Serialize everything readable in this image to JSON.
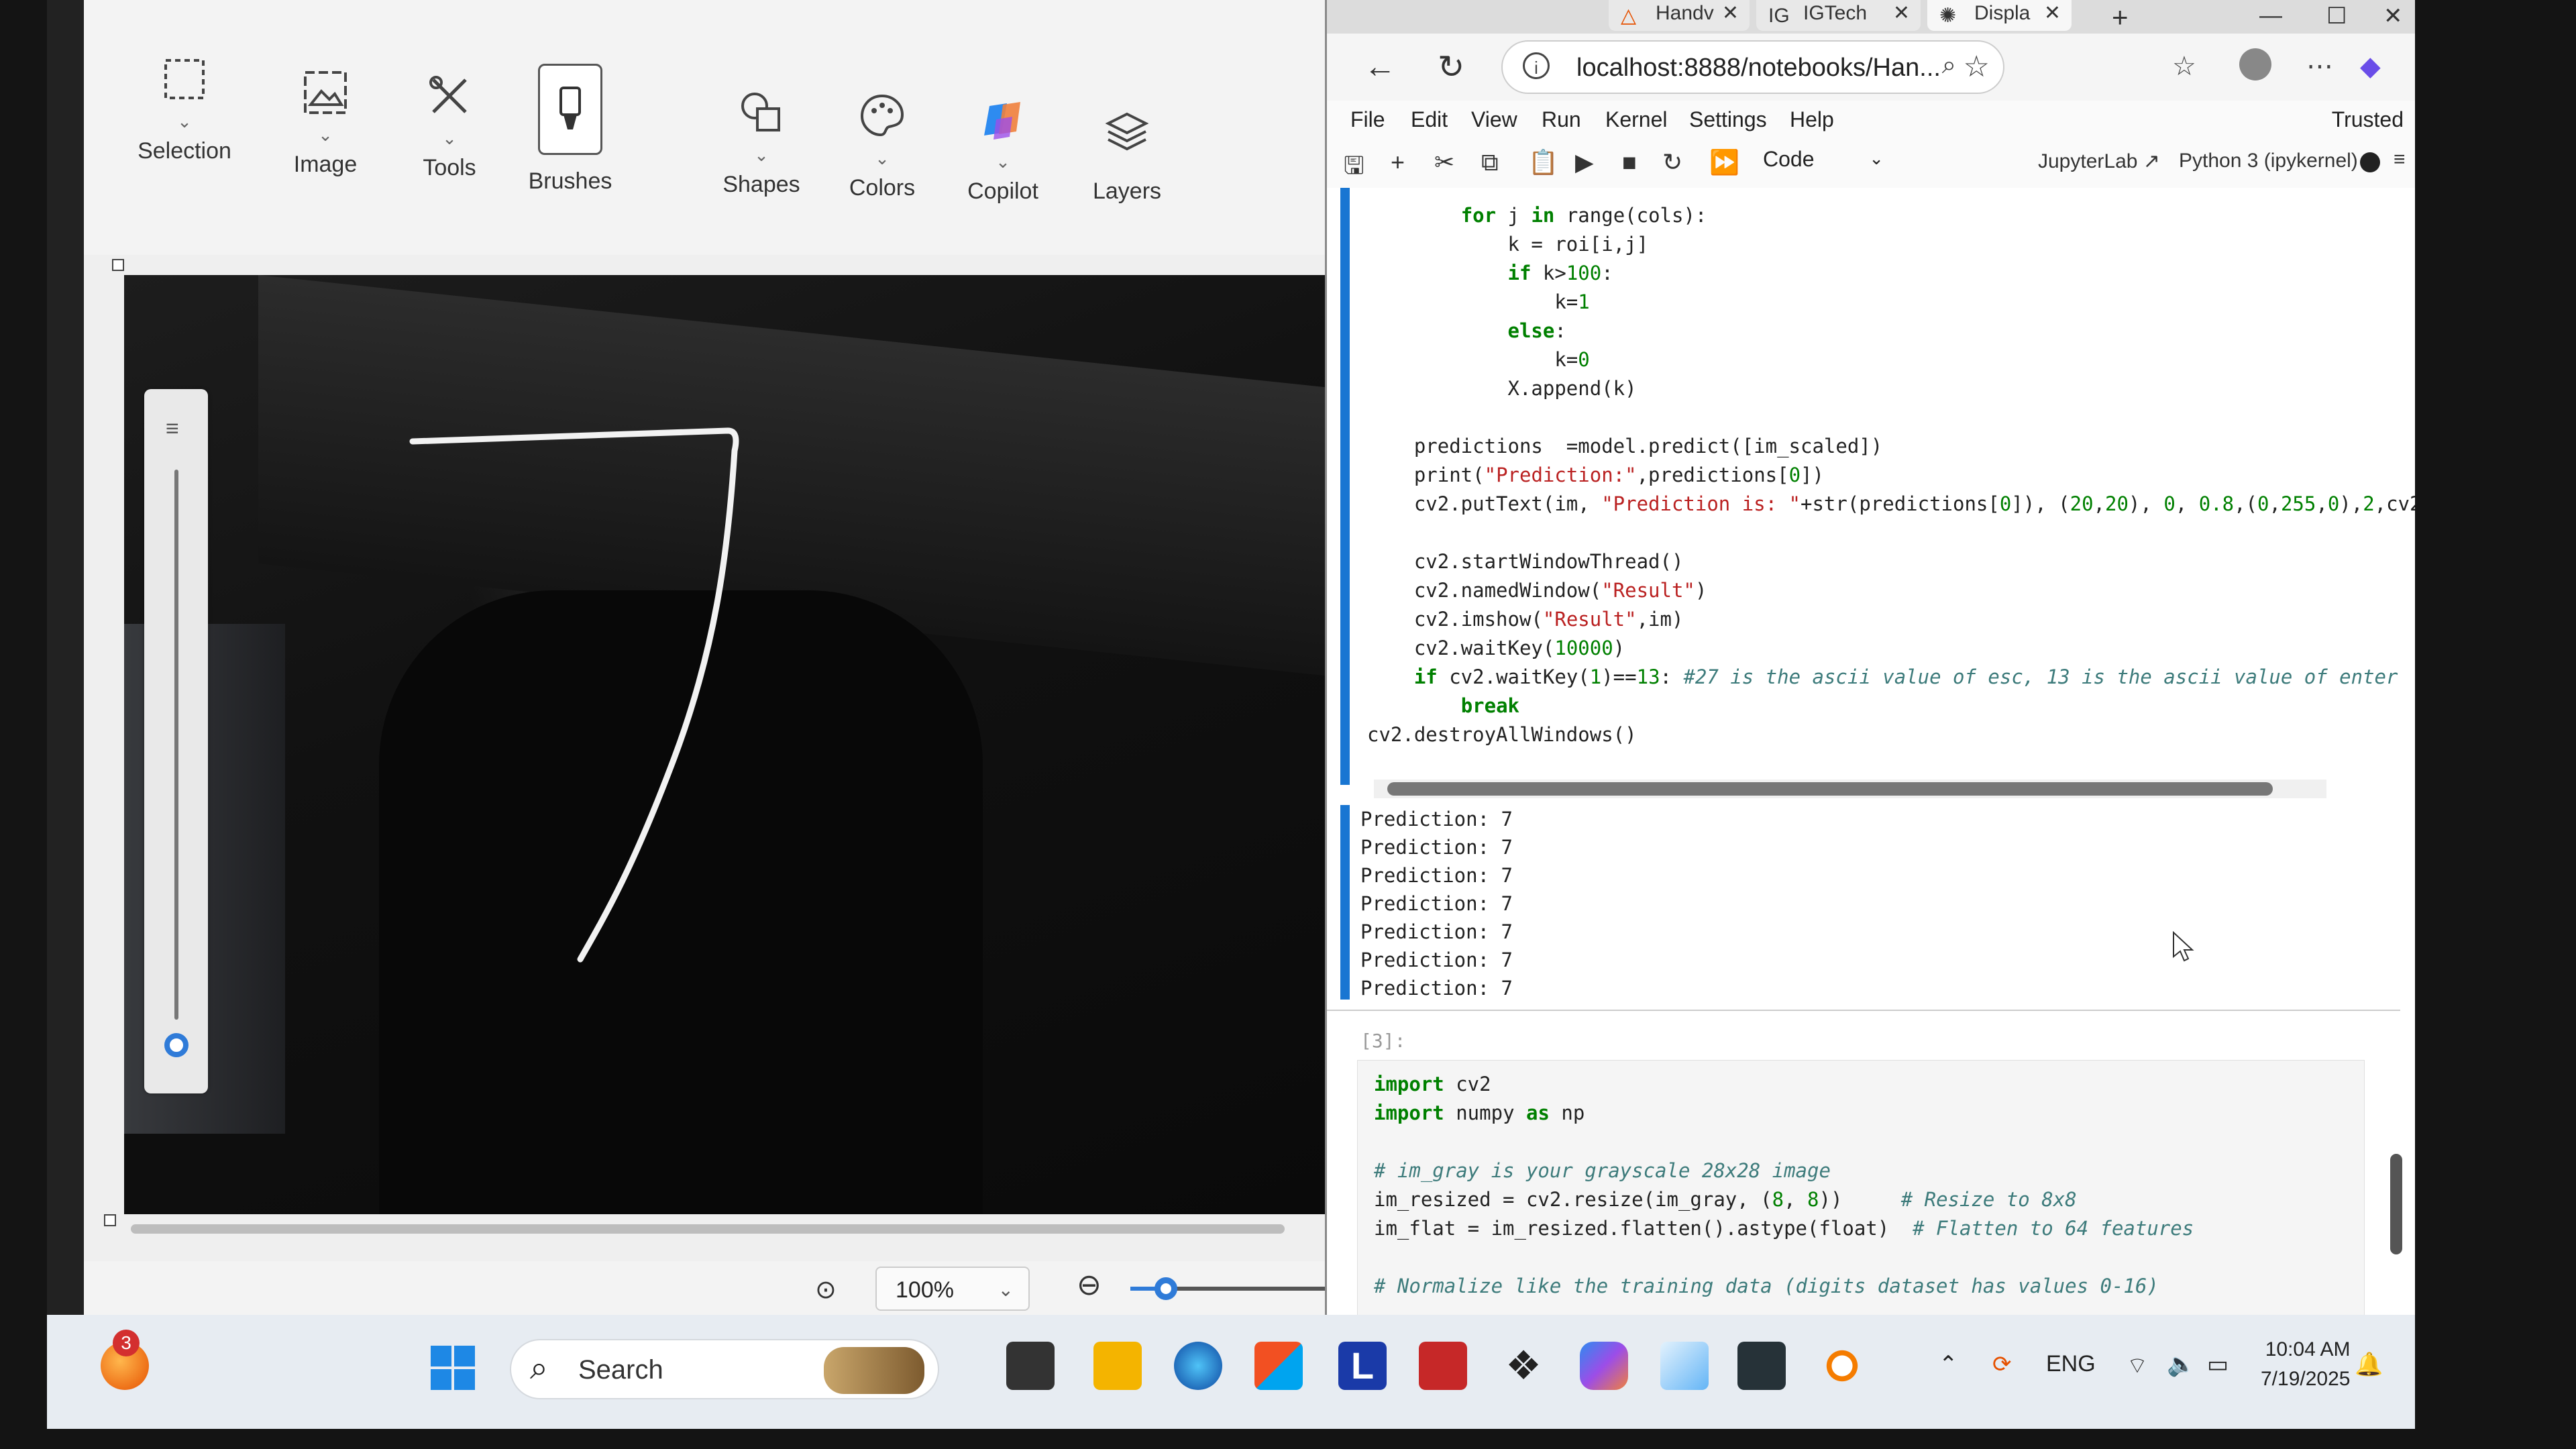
{
  "paint": {
    "ribbon": [
      {
        "label": "Selection",
        "icon": "selection-icon"
      },
      {
        "label": "Image",
        "icon": "image-icon"
      },
      {
        "label": "Tools",
        "icon": "tools-icon"
      },
      {
        "label": "Brushes",
        "icon": "brush-icon"
      },
      {
        "label": "Shapes",
        "icon": "shapes-icon"
      },
      {
        "label": "Colors",
        "icon": "palette-icon"
      },
      {
        "label": "Copilot",
        "icon": "copilot-icon"
      },
      {
        "label": "Layers",
        "icon": "layers-icon"
      }
    ],
    "zoom": "100%",
    "stroke_color": "#f2f2f2"
  },
  "browser": {
    "tabs": [
      {
        "title": "Handv"
      },
      {
        "title": "IGTech"
      },
      {
        "title": "Displa"
      }
    ],
    "url": "localhost:8888/notebooks/Han...",
    "menu": [
      "File",
      "Edit",
      "View",
      "Run",
      "Kernel",
      "Settings",
      "Help"
    ],
    "trusted": "Trusted",
    "cell_type": "Code",
    "jupyterlab": "JupyterLab",
    "kernel": "Python 3 (ipykernel)",
    "accent": "#1976d2"
  },
  "notebook": {
    "outputs": [
      "Prediction: 7",
      "Prediction: 7",
      "Prediction: 7",
      "Prediction: 7",
      "Prediction: 7",
      "Prediction: 7",
      "Prediction: 7"
    ],
    "cell_prompt": "[3]:"
  },
  "taskbar": {
    "search": "Search",
    "notification_count": "3",
    "language": "ENG",
    "time": "10:04 AM",
    "date": "7/19/2025"
  }
}
